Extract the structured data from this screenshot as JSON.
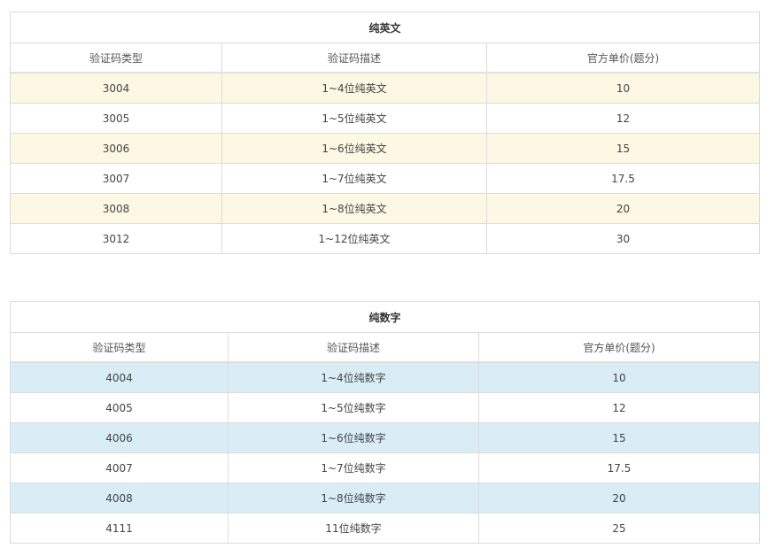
{
  "tables": [
    {
      "title": "纯英文",
      "columns": [
        "验证码类型",
        "验证码描述",
        "官方单价(题分)"
      ],
      "rows": [
        [
          "3004",
          "1~4位纯英文",
          "10"
        ],
        [
          "3005",
          "1~5位纯英文",
          "12"
        ],
        [
          "3006",
          "1~6位纯英文",
          "15"
        ],
        [
          "3007",
          "1~7位纯英文",
          "17.5"
        ],
        [
          "3008",
          "1~8位纯英文",
          "20"
        ],
        [
          "3012",
          "1~12位纯英文",
          "30"
        ]
      ],
      "stripe_color": "#fcf8e3"
    },
    {
      "title": "纯数字",
      "columns": [
        "验证码类型",
        "验证码描述",
        "官方单价(题分)"
      ],
      "rows": [
        [
          "4004",
          "1~4位纯数字",
          "10"
        ],
        [
          "4005",
          "1~5位纯数字",
          "12"
        ],
        [
          "4006",
          "1~6位纯数字",
          "15"
        ],
        [
          "4007",
          "1~7位纯数字",
          "17.5"
        ],
        [
          "4008",
          "1~8位纯数字",
          "20"
        ],
        [
          "4111",
          "11位纯数字",
          "25"
        ]
      ],
      "stripe_color": "#d9edf7"
    }
  ]
}
